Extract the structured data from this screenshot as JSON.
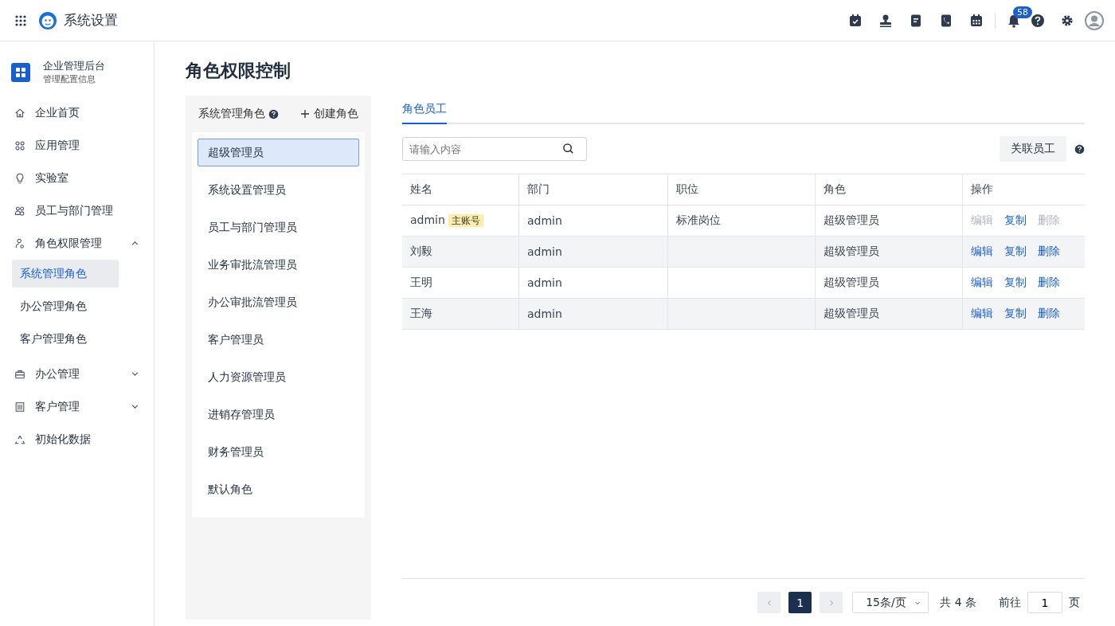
{
  "header": {
    "title": "系统设置",
    "notification_count": "58"
  },
  "sidebar": {
    "org_name": "企业管理后台",
    "org_subtitle": "管理配置信息",
    "items": [
      {
        "label": "企业首页"
      },
      {
        "label": "应用管理"
      },
      {
        "label": "实验室"
      },
      {
        "label": "员工与部门管理"
      },
      {
        "label": "角色权限管理",
        "expanded": true,
        "children": [
          {
            "label": "系统管理角色",
            "selected": true
          },
          {
            "label": "办公管理角色",
            "selected": false
          },
          {
            "label": "客户管理角色",
            "selected": false
          }
        ]
      },
      {
        "label": "办公管理",
        "expanded": false
      },
      {
        "label": "客户管理",
        "expanded": false
      },
      {
        "label": "初始化数据"
      }
    ]
  },
  "page_title": "角色权限控制",
  "roles_panel": {
    "title": "系统管理角色",
    "create_label": "创建角色",
    "roles": [
      {
        "label": "超级管理员",
        "selected": true
      },
      {
        "label": "系统设置管理员",
        "selected": false
      },
      {
        "label": "员工与部门管理员",
        "selected": false
      },
      {
        "label": "业务审批流管理员",
        "selected": false
      },
      {
        "label": "办公审批流管理员",
        "selected": false
      },
      {
        "label": "客户管理员",
        "selected": false
      },
      {
        "label": "人力资源管理员",
        "selected": false
      },
      {
        "label": "进销存管理员",
        "selected": false
      },
      {
        "label": "财务管理员",
        "selected": false
      },
      {
        "label": "默认角色",
        "selected": false
      }
    ]
  },
  "tabs": [
    {
      "label": "角色员工",
      "selected": true
    }
  ],
  "search": {
    "placeholder": "请输入内容"
  },
  "link_button": "关联员工",
  "table": {
    "columns": [
      "姓名",
      "部门",
      "职位",
      "角色",
      "操作"
    ],
    "rows": [
      {
        "name": "admin",
        "badge": "主账号",
        "department": "admin",
        "position": "标准岗位",
        "role": "超级管理员",
        "actions": [
          {
            "label": "编辑",
            "disabled": true
          },
          {
            "label": "复制",
            "disabled": false
          },
          {
            "label": "删除",
            "disabled": true
          }
        ]
      },
      {
        "name": "刘毅",
        "department": "admin",
        "role": "超级管理员",
        "actions": [
          {
            "label": "编辑",
            "disabled": false
          },
          {
            "label": "复制",
            "disabled": false
          },
          {
            "label": "删除",
            "disabled": false
          }
        ]
      },
      {
        "name": "王明",
        "department": "admin",
        "role": "超级管理员",
        "actions": [
          {
            "label": "编辑",
            "disabled": false
          },
          {
            "label": "复制",
            "disabled": false
          },
          {
            "label": "删除",
            "disabled": false
          }
        ]
      },
      {
        "name": "王海",
        "department": "admin",
        "role": "超级管理员",
        "actions": [
          {
            "label": "编辑",
            "disabled": false
          },
          {
            "label": "复制",
            "disabled": false
          },
          {
            "label": "删除",
            "disabled": false
          }
        ]
      }
    ]
  },
  "pagination": {
    "prev_disabled": true,
    "next_disabled": true,
    "pages": [
      {
        "label": "1",
        "selected": true
      }
    ],
    "page_size": "15条/页",
    "total": "共 4 条",
    "goto_label": "前往",
    "goto_value": "1",
    "goto_suffix": "页"
  }
}
